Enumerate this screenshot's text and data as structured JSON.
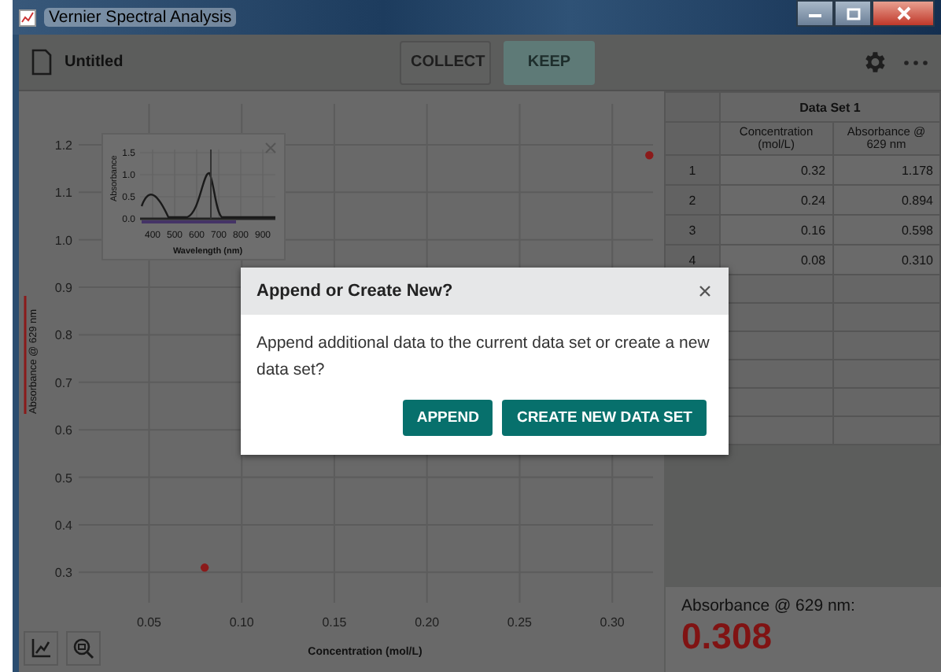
{
  "window": {
    "title": "Vernier Spectral Analysis"
  },
  "toolbar": {
    "file_name": "Untitled",
    "buttons": [
      {
        "label": "COLLECT",
        "kind": "outline"
      },
      {
        "label": "KEEP",
        "kind": "filled"
      }
    ]
  },
  "graph": {
    "chart_data": {
      "type": "scatter",
      "xlabel": "Concentration (mol/L)",
      "ylabel": "Absorbance @ 629 nm",
      "grid": true,
      "xlim": [
        0.012,
        0.322
      ],
      "ylim": [
        0.236,
        1.286
      ],
      "xticks": [
        {
          "value": 0.05,
          "label": "0.05"
        },
        {
          "value": 0.1,
          "label": "0.10"
        },
        {
          "value": 0.15,
          "label": "0.15"
        },
        {
          "value": 0.2,
          "label": "0.20"
        },
        {
          "value": 0.25,
          "label": "0.25"
        },
        {
          "value": 0.3,
          "label": "0.30"
        }
      ],
      "yticks": [
        {
          "value": 0.3,
          "label": "0.3"
        },
        {
          "value": 0.4,
          "label": "0.4"
        },
        {
          "value": 0.5,
          "label": "0.5"
        },
        {
          "value": 0.6,
          "label": "0.6"
        },
        {
          "value": 0.7,
          "label": "0.7"
        },
        {
          "value": 0.8,
          "label": "0.8"
        },
        {
          "value": 0.9,
          "label": "0.9"
        },
        {
          "value": 1.0,
          "label": "1.0"
        },
        {
          "value": 1.1,
          "label": "1.1"
        },
        {
          "value": 1.2,
          "label": "1.2"
        }
      ],
      "x": [
        0.08,
        0.32
      ],
      "series": [
        {
          "color": "#8b1a1a",
          "values": [
            0.31,
            1.178
          ]
        }
      ]
    },
    "inset": {
      "ylabel": "Absorbance",
      "xlabel": "Wavelength (nm)",
      "yticks": [
        "1.5",
        "1.0",
        "0.5",
        "0.0"
      ],
      "xticks": [
        "400",
        "500",
        "600",
        "700",
        "800",
        "900"
      ]
    }
  },
  "table": {
    "title": "Data Set 1",
    "columns": [
      "Concentration (mol/L)",
      "Absorbance @ 629 nm"
    ],
    "rows": [
      {
        "index": "1",
        "cells": [
          "0.32",
          "1.178"
        ]
      },
      {
        "index": "2",
        "cells": [
          "0.24",
          "0.894"
        ]
      },
      {
        "index": "3",
        "cells": [
          "0.16",
          "0.598"
        ]
      },
      {
        "index": "4",
        "cells": [
          "0.08",
          "0.310"
        ]
      }
    ]
  },
  "readout": {
    "label": "Absorbance @ 629 nm:",
    "value": "0.308"
  },
  "dialog": {
    "title": "Append or Create New?",
    "message": "Append additional data to the current data set or create a new data set?",
    "buttons": [
      "APPEND",
      "CREATE NEW DATA SET"
    ]
  }
}
